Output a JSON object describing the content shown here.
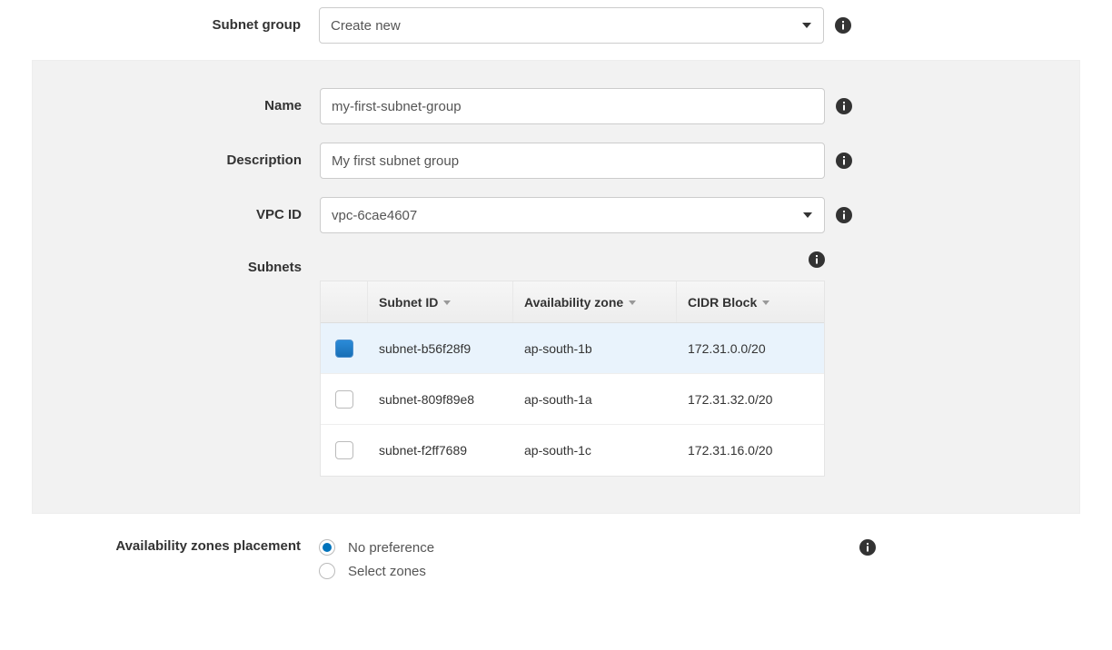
{
  "subnet_group": {
    "label": "Subnet group",
    "selected": "Create new"
  },
  "panel": {
    "name_label": "Name",
    "name_value": "my-first-subnet-group",
    "description_label": "Description",
    "description_value": "My first subnet group",
    "vpc_label": "VPC ID",
    "vpc_value": "vpc-6cae4607",
    "subnets_label": "Subnets",
    "table": {
      "headers": {
        "subnet_id": "Subnet ID",
        "az": "Availability zone",
        "cidr": "CIDR Block"
      },
      "rows": [
        {
          "selected": true,
          "subnet_id": "subnet-b56f28f9",
          "az": "ap-south-1b",
          "cidr": "172.31.0.0/20"
        },
        {
          "selected": false,
          "subnet_id": "subnet-809f89e8",
          "az": "ap-south-1a",
          "cidr": "172.31.32.0/20"
        },
        {
          "selected": false,
          "subnet_id": "subnet-f2ff7689",
          "az": "ap-south-1c",
          "cidr": "172.31.16.0/20"
        }
      ]
    }
  },
  "az_placement": {
    "label": "Availability zones placement",
    "options": [
      {
        "label": "No preference",
        "selected": true
      },
      {
        "label": "Select zones",
        "selected": false
      }
    ]
  },
  "icons": {
    "info": "info-icon",
    "caret": "chevron-down-icon",
    "sort": "sort-caret-icon"
  }
}
